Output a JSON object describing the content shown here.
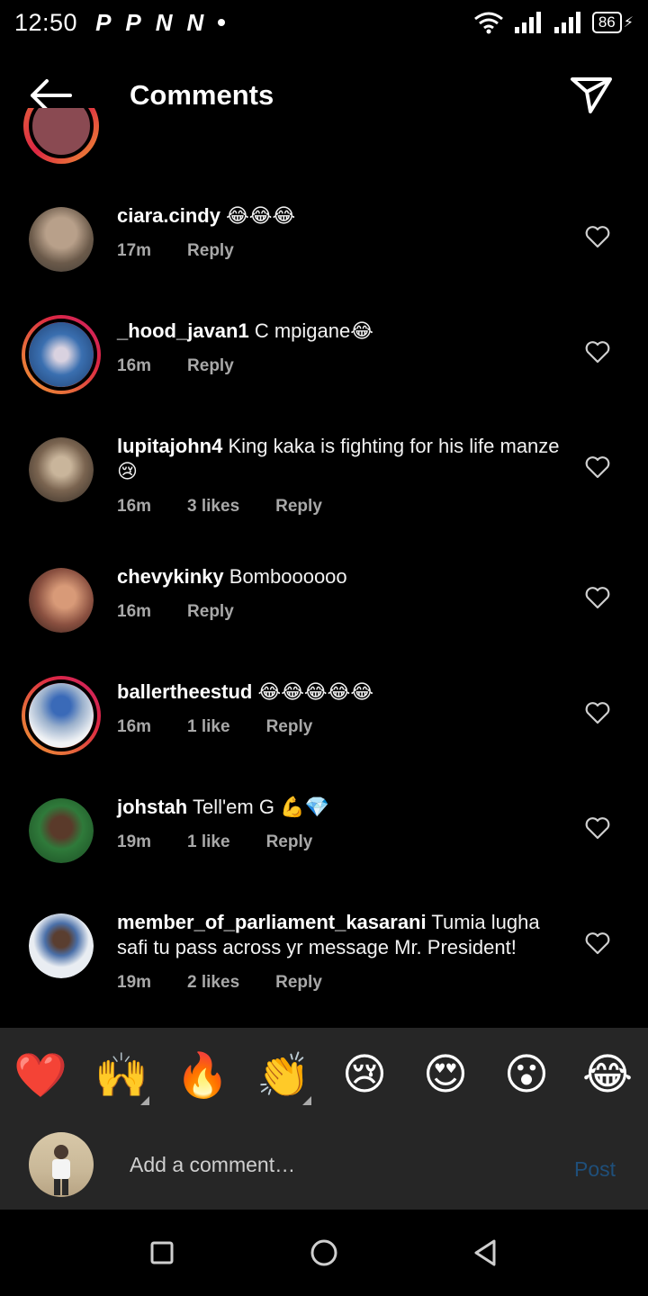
{
  "status_bar": {
    "time": "12:50",
    "notifications": [
      "P",
      "P",
      "N",
      "N"
    ],
    "battery": "86"
  },
  "header": {
    "title": "Comments"
  },
  "comments": [
    {
      "username": "ciara.cindy",
      "text": "😂😂😂",
      "time": "17m",
      "likes": "",
      "reply": "Reply",
      "avatar_color": "#6b5a4a",
      "story": false
    },
    {
      "username": "_hood_javan1",
      "text": "C mpigane😂",
      "time": "16m",
      "likes": "",
      "reply": "Reply",
      "avatar_color": "#3a6fb0",
      "story": true
    },
    {
      "username": "lupitajohn4",
      "text": "King kaka is fighting for his life manze😢",
      "time": "16m",
      "likes": "3 likes",
      "reply": "Reply",
      "avatar_color": "#7a6450",
      "story": false
    },
    {
      "username": "chevykinky",
      "text": "Bomboooooo",
      "time": "16m",
      "likes": "",
      "reply": "Reply",
      "avatar_color": "#8a5040",
      "story": false
    },
    {
      "username": "ballertheestud",
      "text": "😂😂😂😂😂",
      "time": "16m",
      "likes": "1 like",
      "reply": "Reply",
      "avatar_color": "#dfe6ee",
      "story": true
    },
    {
      "username": "johstah",
      "text": "Tell'em G 💪💎",
      "time": "19m",
      "likes": "1 like",
      "reply": "Reply",
      "avatar_color": "#2f7a3a",
      "story": false
    },
    {
      "username": "member_of_parliament_kasarani",
      "text": "Tumia lugha safi tu pass across yr message Mr. President!",
      "time": "19m",
      "likes": "2 likes",
      "reply": "Reply",
      "avatar_color": "#e9edf2",
      "story": false
    }
  ],
  "reactions": [
    "❤️",
    "🙌",
    "🔥",
    "👏",
    "😢",
    "😍",
    "😮",
    "😂"
  ],
  "composer": {
    "placeholder": "Add a comment…",
    "post_label": "Post"
  }
}
